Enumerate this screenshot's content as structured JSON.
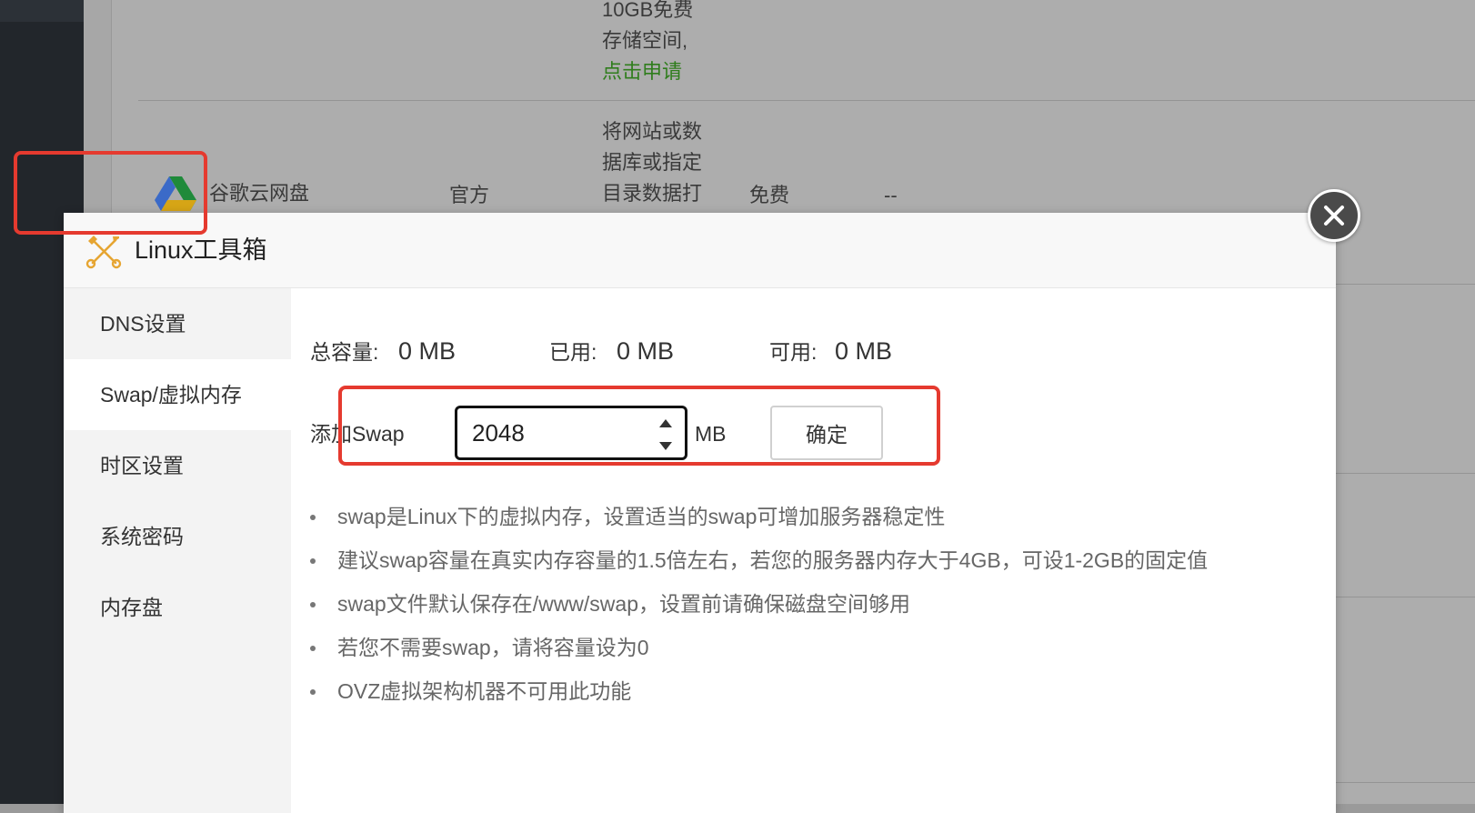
{
  "background": {
    "desc_lines": [
      "10GB免费",
      "存储空间,"
    ],
    "desc_link": "点击申请",
    "drive_desc_lines": [
      "将网站或数",
      "据库或指定",
      "目录数据打"
    ],
    "drive_row": {
      "name": "谷歌云网盘",
      "developer": "官方",
      "price": "免费",
      "status": "--"
    }
  },
  "modal": {
    "title": "Linux工具箱",
    "header_icon": "tools-icon",
    "close_icon": "close-icon"
  },
  "sidebar": {
    "items": [
      {
        "label": "DNS设置"
      },
      {
        "label": "Swap/虚拟内存"
      },
      {
        "label": "时区设置"
      },
      {
        "label": "系统密码"
      },
      {
        "label": "内存盘"
      }
    ],
    "active_index": 1
  },
  "swap": {
    "total_label": "总容量:",
    "total_value": "0 MB",
    "used_label": "已用:",
    "used_value": "0 MB",
    "available_label": "可用:",
    "available_value": "0 MB",
    "add_label": "添加Swap",
    "input_value": "2048",
    "unit": "MB",
    "confirm_label": "确定"
  },
  "notes": [
    "swap是Linux下的虚拟内存，设置适当的swap可增加服务器稳定性",
    "建议swap容量在真实内存容量的1.5倍左右，若您的服务器内存大于4GB，可设1-2GB的固定值",
    "swap文件默认保存在/www/swap，设置前请确保磁盘空间够用",
    "若您不需要swap，请将容量设为0",
    "OVZ虚拟架构机器不可用此功能"
  ],
  "colors": {
    "highlight": "#e53a2f",
    "link_green": "#2f7d1c"
  }
}
